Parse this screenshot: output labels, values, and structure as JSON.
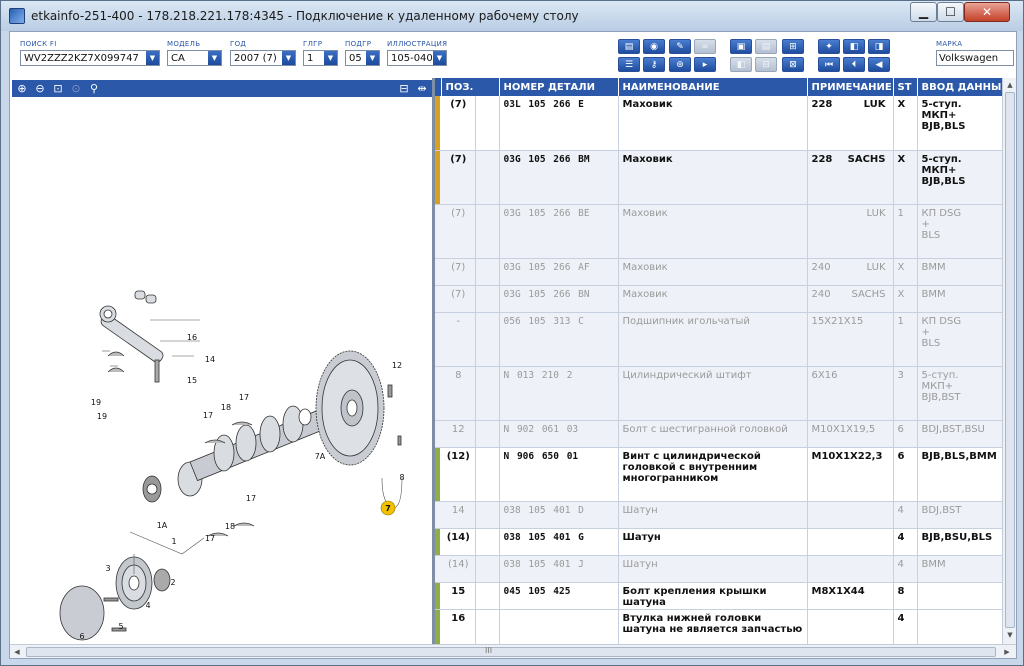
{
  "window": {
    "title": "etkainfo-251-400 - 178.218.221.178:4345 - Подключение к удаленному рабочему столу",
    "btn_min": "▁",
    "btn_max": "☐",
    "btn_close": "✕"
  },
  "filters": {
    "vin": {
      "label": "ПОИСК FI",
      "value": "WV2ZZZ2KZ7X099747"
    },
    "model": {
      "label": "МОДЕЛЬ",
      "value": "CA"
    },
    "year": {
      "label": "ГОД",
      "value": "2007 (7)"
    },
    "mgroup": {
      "label": "ГЛГР",
      "value": "1"
    },
    "sgroup": {
      "label": "ПОДГР",
      "value": "05"
    },
    "illustration": {
      "label": "ИЛЛЮСТРАЦИЯ",
      "value": "105-040"
    },
    "brand": {
      "label": "МАРКА",
      "value": "Volkswagen"
    }
  },
  "grid": {
    "headers": [
      "ПОЗ.",
      "НОМЕР ДЕТАЛИ",
      "НАИМЕНОВАНИЕ",
      "ПРИМЕЧАНИЕ",
      "ST",
      "ВВОД ДАННЫХ"
    ],
    "rows": [
      {
        "pos": "(7)",
        "part": "03L 105 266 E",
        "name": "Маховик",
        "note": "228",
        "note2": "LUK",
        "st": "X",
        "data": "5-ступ.\nМКП+\nBJB,BLS",
        "marker": "#d8a020",
        "state": "act sel",
        "size": "r1"
      },
      {
        "pos": "(7)",
        "part": "03G 105 266 BM",
        "name": "Маховик",
        "note": "228",
        "note2": "SACHS",
        "st": "X",
        "data": "5-ступ.\nМКП+\nBJB,BLS",
        "marker": "#d8a020",
        "state": "act alt",
        "size": "r1"
      },
      {
        "pos": "(7)",
        "part": "03G 105 266 BE",
        "name": "Маховик",
        "note": "",
        "note2": "LUK",
        "st": "1",
        "data": "КП DSG\n+\nBLS",
        "marker": "",
        "state": "dim alt",
        "size": "r1"
      },
      {
        "pos": "(7)",
        "part": "03G 105 266 AF",
        "name": "Маховик",
        "note": "240",
        "note2": "LUK",
        "st": "X",
        "data": "BMM",
        "marker": "",
        "state": "dim alt",
        "size": "r2"
      },
      {
        "pos": "(7)",
        "part": "03G 105 266 BN",
        "name": "Маховик",
        "note": "240",
        "note2": "SACHS",
        "st": "X",
        "data": "BMM",
        "marker": "",
        "state": "dim alt",
        "size": "r2"
      },
      {
        "pos": "-",
        "part": "056 105 313 C",
        "name": "Подшипник игольчатый",
        "note": "15X21X15",
        "note2": "",
        "st": "1",
        "data": "КП DSG\n+\nBLS",
        "marker": "",
        "state": "dim alt",
        "size": "r1"
      },
      {
        "pos": "8",
        "part": "N 013 210 2",
        "name": "Цилиндрический штифт",
        "note": "6X16",
        "note2": "",
        "st": "3",
        "data": "5-ступ.\nМКП+\nBJB,BST",
        "marker": "",
        "state": "dim alt",
        "size": "r1"
      },
      {
        "pos": "12",
        "part": "N 902 061 03",
        "name": "Болт с шестигранной головкой",
        "note": "M10X1X19,5",
        "note2": "",
        "st": "6",
        "data": "BDJ,BST,BSU",
        "marker": "",
        "state": "dim alt",
        "size": "r2"
      },
      {
        "pos": "(12)",
        "part": "N 906 650 01",
        "name": "Винт с цилиндрической головкой с внутренним многогранником",
        "note": "M10X1X22,3",
        "note2": "",
        "st": "6",
        "data": "BJB,BLS,BMM",
        "marker": "#8fae4a",
        "state": "act",
        "size": "r1"
      },
      {
        "pos": "14",
        "part": "038 105 401 D",
        "name": "Шатун",
        "note": "",
        "note2": "",
        "st": "4",
        "data": "BDJ,BST",
        "marker": "",
        "state": "dim alt",
        "size": "r2"
      },
      {
        "pos": "(14)",
        "part": "038 105 401 G",
        "name": "Шатун",
        "note": "",
        "note2": "",
        "st": "4",
        "data": "BJB,BSU,BLS",
        "marker": "#8fae4a",
        "state": "act",
        "size": "r2"
      },
      {
        "pos": "(14)",
        "part": "038 105 401 J",
        "name": "Шатун",
        "note": "",
        "note2": "",
        "st": "4",
        "data": "BMM",
        "marker": "",
        "state": "dim alt",
        "size": "r2"
      },
      {
        "pos": "15",
        "part": "045 105 425",
        "name": "Болт крепления крышки шатуна",
        "note": "M8X1X44",
        "note2": "",
        "st": "8",
        "data": "",
        "marker": "#8fae4a",
        "state": "act",
        "size": "r2"
      },
      {
        "pos": "16",
        "part": "",
        "name": "Втулка нижней головки шатуна не является запчастью",
        "note": "",
        "note2": "",
        "st": "4",
        "data": "",
        "marker": "#8fae4a",
        "state": "act",
        "size": "r1"
      }
    ]
  },
  "illustration": {
    "callouts": [
      "16",
      "14",
      "15",
      "19",
      "19",
      "17",
      "18",
      "17",
      "12",
      "7A",
      "8",
      "7",
      "1A",
      "1",
      "17",
      "18",
      "17",
      "3",
      "2",
      "4",
      "5",
      "6"
    ],
    "highlight_color": "#f2c200"
  },
  "scroll": {
    "grip": "III",
    "up": "▲",
    "down": "▼",
    "left": "◀",
    "right": "▶"
  },
  "colors": {
    "accent": "#2b58a8",
    "marker_gold": "#d8a020",
    "marker_green": "#8fae4a"
  }
}
